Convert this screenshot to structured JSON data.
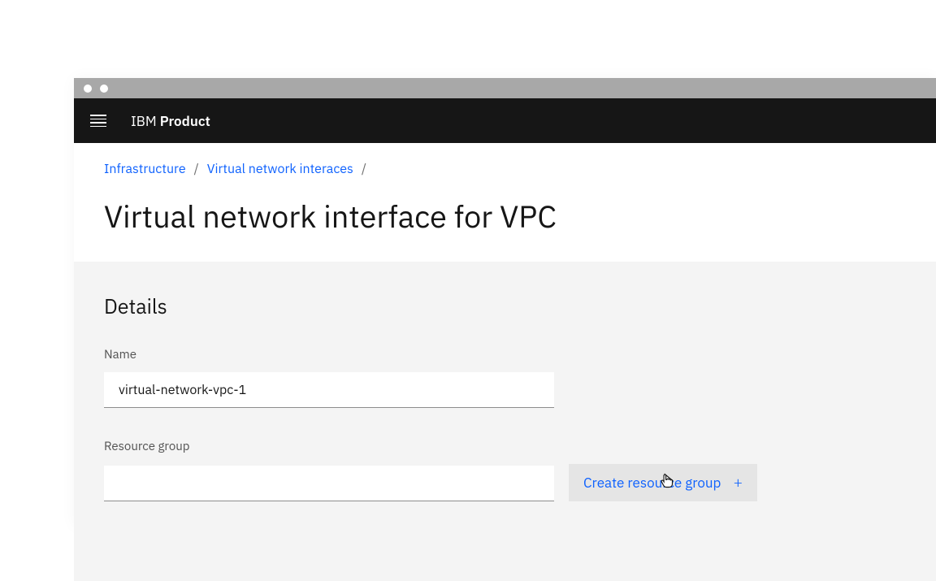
{
  "header": {
    "brand_prefix": "IBM",
    "brand_name": "Product"
  },
  "breadcrumb": {
    "items": [
      "Infrastructure",
      "Virtual network interaces"
    ],
    "separator": "/"
  },
  "page": {
    "title": "Virtual network interface for VPC"
  },
  "details": {
    "heading": "Details",
    "name_label": "Name",
    "name_value": "virtual-network-vpc-1",
    "resource_group_label": "Resource group",
    "resource_group_value": "",
    "create_resource_group_label": "Create resource group",
    "plus_symbol": "+"
  }
}
